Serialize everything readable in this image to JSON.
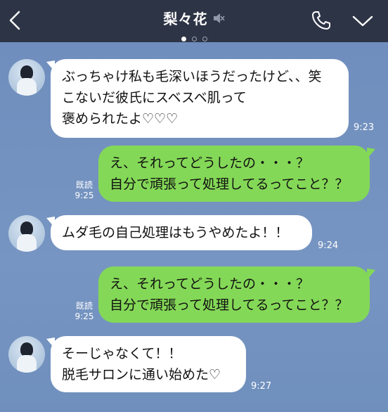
{
  "header": {
    "title": "梨々花",
    "icons": {
      "back": "back-arrow-icon",
      "mute": "mute-speaker-icon",
      "call": "phone-icon",
      "menu": "chevron-down-icon"
    }
  },
  "messages": [
    {
      "side": "in",
      "text": "ぶっちゃけ私も毛深いほうだったけど、、笑\nこないだ彼氏にスベスベ肌って\n褒められたよ♡♡♡",
      "time": "9:23"
    },
    {
      "side": "out",
      "text": "え、それってどうしたの・・・？\n自分で頑張って処理してるってこと？？",
      "time": "9:25",
      "read": "既読"
    },
    {
      "side": "in",
      "text": "ムダ毛の自己処理はもうやめたよ！！",
      "time": "9:24"
    },
    {
      "side": "out",
      "text": "え、それってどうしたの・・・？\n自分で頑張って処理してるってこと？？",
      "time": "9:25",
      "read": "既読"
    },
    {
      "side": "in",
      "text": "そーじゃなくて！！\n脱毛サロンに通い始めた♡",
      "time": "9:27"
    }
  ],
  "colors": {
    "header_bg": "#2d3446",
    "chat_bg": "#7290bd",
    "out_bubble": "#84d857",
    "in_bubble": "#ffffff"
  }
}
